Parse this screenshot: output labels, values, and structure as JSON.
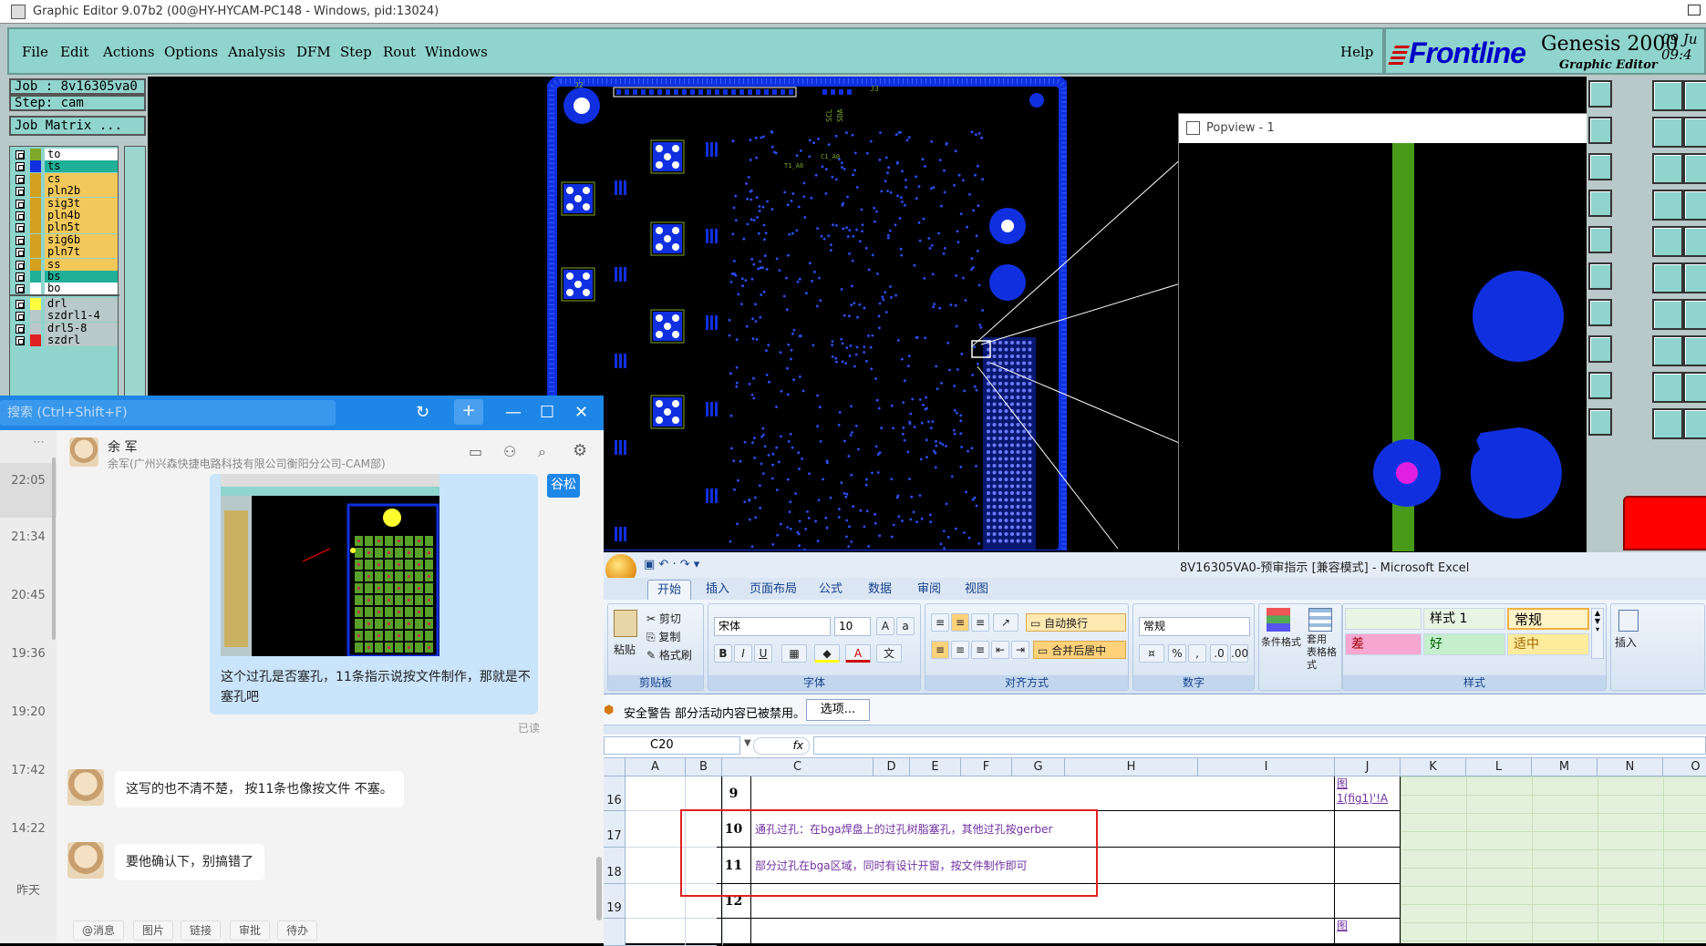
{
  "genesis": {
    "title": "Graphic Editor 9.07b2 (00@HY-HYCAM-PC148 - Windows, pid:13024)",
    "menu": [
      "File",
      "Edit",
      "Actions",
      "Options",
      "Analysis",
      "DFM",
      "Step",
      "Rout",
      "Windows"
    ],
    "help": "Help",
    "brand": {
      "logo": "Frontline",
      "product": "Genesis 2000",
      "subtitle": "Graphic Editor",
      "date1": "09 Ju",
      "date2": "09:4"
    },
    "job": "Job : 8v16305va0",
    "step": "Step: cam",
    "job_matrix": "Job Matrix ...",
    "layers": [
      {
        "name": "to",
        "color": "#7fa82a",
        "bg": "#ffffff",
        "active": true
      },
      {
        "name": "ts",
        "color": "#1030e0",
        "bg": "#20b098",
        "active": false
      },
      {
        "name": "cs",
        "color": "#d4a020",
        "bg": "#f2c85a",
        "active": false
      },
      {
        "name": "pln2b",
        "color": "#d4a020",
        "bg": "#f2c85a",
        "active": false
      },
      {
        "name": "sig3t",
        "color": "#d4a020",
        "bg": "#f2c85a",
        "active": false
      },
      {
        "name": "pln4b",
        "color": "#d4a020",
        "bg": "#f2c85a",
        "active": false
      },
      {
        "name": "pln5t",
        "color": "#d4a020",
        "bg": "#f2c85a",
        "active": false
      },
      {
        "name": "sig6b",
        "color": "#d4a020",
        "bg": "#f2c85a",
        "active": false
      },
      {
        "name": "pln7t",
        "color": "#d4a020",
        "bg": "#f2c85a",
        "active": false
      },
      {
        "name": "ss",
        "color": "#d4a020",
        "bg": "#f2c85a",
        "active": false
      },
      {
        "name": "bs",
        "color": "#20b098",
        "bg": "#20b098",
        "active": false
      },
      {
        "name": "bo",
        "color": "#ffffff",
        "bg": "#ffffff",
        "active": true
      }
    ],
    "drill_layers": [
      {
        "name": "drl",
        "color": "#ffff40",
        "bg": "#b9c8c8"
      },
      {
        "name": "szdrl1-4",
        "color": "#b9c8c8",
        "bg": "#b9c8c8"
      },
      {
        "name": "drl5-8",
        "color": "#b9c8c8",
        "bg": "#b9c8c8"
      },
      {
        "name": "szdrl",
        "color": "#e02020",
        "bg": "#b9c8c8"
      }
    ],
    "board_labels": {
      "j2": "J2",
      "j3": "J3",
      "scl": "SCL",
      "sda": "SDA",
      "j0": "Jo_A0",
      "j1": "Jo_A1",
      "j2b": "Jo_A2",
      "jA": "Jo_A3",
      "t1": "T1_A0",
      "c1": "C1_A0",
      "c2": "C2_A0"
    },
    "popview_title": "Popview - 1"
  },
  "chat": {
    "search_placeholder": "搜索 (Ctrl+Shift+F)",
    "contact_name": "余 军",
    "contact_org": "余军(广州兴森快捷电路科技有限公司衡阳分公司-CAM部)",
    "times": [
      "22:05",
      "21:34",
      "20:45",
      "19:36",
      "19:20",
      "17:42",
      "14:22",
      "昨天"
    ],
    "msg_sent": "这个过孔是否塞孔，11条指示说按文件制作，那就是不塞孔吧",
    "read_status": "已读",
    "tag": "谷松",
    "msg_recv1": "这写的也不清不楚， 按11条也像按文件 不塞。",
    "msg_recv2": "要他确认下，别搞错了",
    "quick": [
      "@消息",
      "图片",
      "链接",
      "审批",
      "待办"
    ]
  },
  "excel": {
    "title": "8V16305VA0-预审指示  [兼容模式] - Microsoft Excel",
    "tabs": [
      "开始",
      "插入",
      "页面布局",
      "公式",
      "数据",
      "审阅",
      "视图"
    ],
    "clipboard": {
      "paste": "粘贴",
      "cut": "剪切",
      "copy": "复制",
      "format": "格式刷",
      "label": "剪贴板"
    },
    "font": {
      "name": "宋体",
      "size": "10",
      "label": "字体"
    },
    "align": {
      "wrap": "自动换行",
      "merge": "合并后居中",
      "label": "对齐方式"
    },
    "number": {
      "format": "常规",
      "label": "数字"
    },
    "styles": {
      "cond": "条件格式",
      "table": "套用\n表格格式",
      "label": "样式",
      "s1": "样式 1",
      "normal": "常规",
      "bad": "差",
      "good": "好",
      "neutral": "适中"
    },
    "insert": "插入",
    "security": {
      "label": "安全警告",
      "text": "部分活动内容已被禁用。",
      "button": "选项..."
    },
    "namebox": "C20",
    "fx": "fx",
    "columns": [
      "A",
      "B",
      "C",
      "D",
      "E",
      "F",
      "G",
      "H",
      "I",
      "J",
      "K",
      "L",
      "M",
      "N",
      "O"
    ],
    "rows": [
      {
        "row": "16",
        "num": "9",
        "text": "",
        "j": "图\n1(fig1)'!A"
      },
      {
        "row": "17",
        "num": "10",
        "text": "通孔过孔：在bga焊盘上的过孔树脂塞孔，其他过孔按gerber",
        "j": ""
      },
      {
        "row": "18",
        "num": "11",
        "text": "部分过孔在bga区域，同时有设计开窗，按文件制作即可",
        "j": ""
      },
      {
        "row": "19",
        "num": "12",
        "text": "",
        "j": ""
      },
      {
        "row": "",
        "num": "",
        "text": "",
        "j": "图"
      }
    ]
  }
}
